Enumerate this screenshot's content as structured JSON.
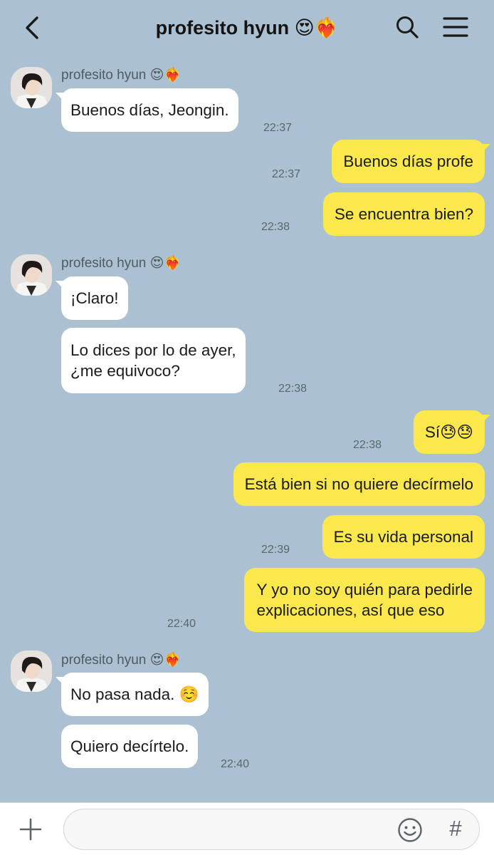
{
  "header": {
    "title": "profesito hyun 😍❤️‍🔥",
    "icons": {
      "back": "chevron-left-icon",
      "search": "search-icon",
      "menu": "hamburger-menu-icon"
    }
  },
  "sender_name": "profesito hyun 😍❤️‍🔥",
  "messages": [
    {
      "from": "contact",
      "text": "Buenos días, Jeongin.",
      "time": "22:37"
    },
    {
      "from": "me",
      "text": "Buenos días profe",
      "time": "22:37"
    },
    {
      "from": "me",
      "text": "Se encuentra bien?",
      "time": "22:38"
    },
    {
      "from": "contact",
      "text": "¡Claro!"
    },
    {
      "from": "contact",
      "lines": [
        "Lo dices por lo de ayer,",
        "¿me equivoco?"
      ],
      "time": "22:38"
    },
    {
      "from": "me",
      "text": "Sí😓😓",
      "time": "22:38"
    },
    {
      "from": "me",
      "text": "Está bien si no quiere decírmelo"
    },
    {
      "from": "me",
      "text": "Es su vida personal",
      "time": "22:39"
    },
    {
      "from": "me",
      "lines": [
        "Y yo no soy quién para pedirle",
        "explicaciones, así que eso"
      ],
      "time": "22:40"
    },
    {
      "from": "contact",
      "text": "No pasa nada. ☺️"
    },
    {
      "from": "contact",
      "text": "Quiero decírtelo.",
      "time": "22:40"
    }
  ],
  "composer": {
    "placeholder": "",
    "hash_label": "#",
    "icons": {
      "add": "plus-icon",
      "emoji": "smiley-icon",
      "hashtag": "hashtag-icon"
    }
  },
  "colors": {
    "background": "#abc1d1",
    "outgoing_bubble": "#fbe84d",
    "incoming_bubble": "#ffffff"
  }
}
